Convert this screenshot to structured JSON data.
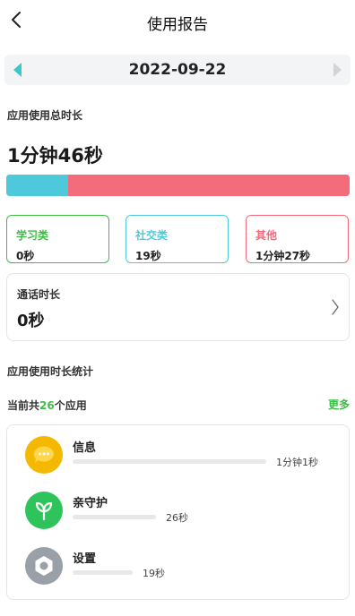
{
  "header": {
    "title": "使用报告",
    "back_icon": "chevron-left-icon"
  },
  "date_bar": {
    "date": "2022-09-22",
    "prev_icon": "triangle-left-icon",
    "next_icon": "triangle-right-icon",
    "accent": "#3cc8c5"
  },
  "total": {
    "label": "应用使用总时长",
    "value": "1分钟46秒"
  },
  "usage_bar": {
    "segments": [
      {
        "category": "学习类",
        "fraction": 0.0,
        "color": "#3bbf44"
      },
      {
        "category": "社交类",
        "fraction": 0.18,
        "color": "#4ec9dc"
      },
      {
        "category": "其他",
        "fraction": 0.82,
        "color": "#f46c7b"
      }
    ]
  },
  "categories": [
    {
      "name": "学习类",
      "value": "0秒",
      "color": "#3bbf44"
    },
    {
      "name": "社交类",
      "value": "19秒",
      "color": "#4ec9dc"
    },
    {
      "name": "其他",
      "value": "1分钟27秒",
      "color": "#f46c7b"
    }
  ],
  "call": {
    "label": "通话时长",
    "value": "0秒",
    "chevron_icon": "chevron-right-icon"
  },
  "stats": {
    "label": "应用使用时长统计",
    "count_prefix": "当前共",
    "count": "26",
    "count_suffix": "个应用",
    "more": "更多"
  },
  "apps": [
    {
      "name": "信息",
      "time": "1分钟1秒",
      "fraction": 1.0,
      "icon": "message-bubble-icon",
      "color": "#f5b800"
    },
    {
      "name": "亲守护",
      "time": "26秒",
      "fraction": 0.43,
      "icon": "sprout-icon",
      "color": "#2fc35b"
    },
    {
      "name": "设置",
      "time": "19秒",
      "fraction": 0.31,
      "icon": "gear-icon",
      "color": "#9aa0a8"
    }
  ]
}
